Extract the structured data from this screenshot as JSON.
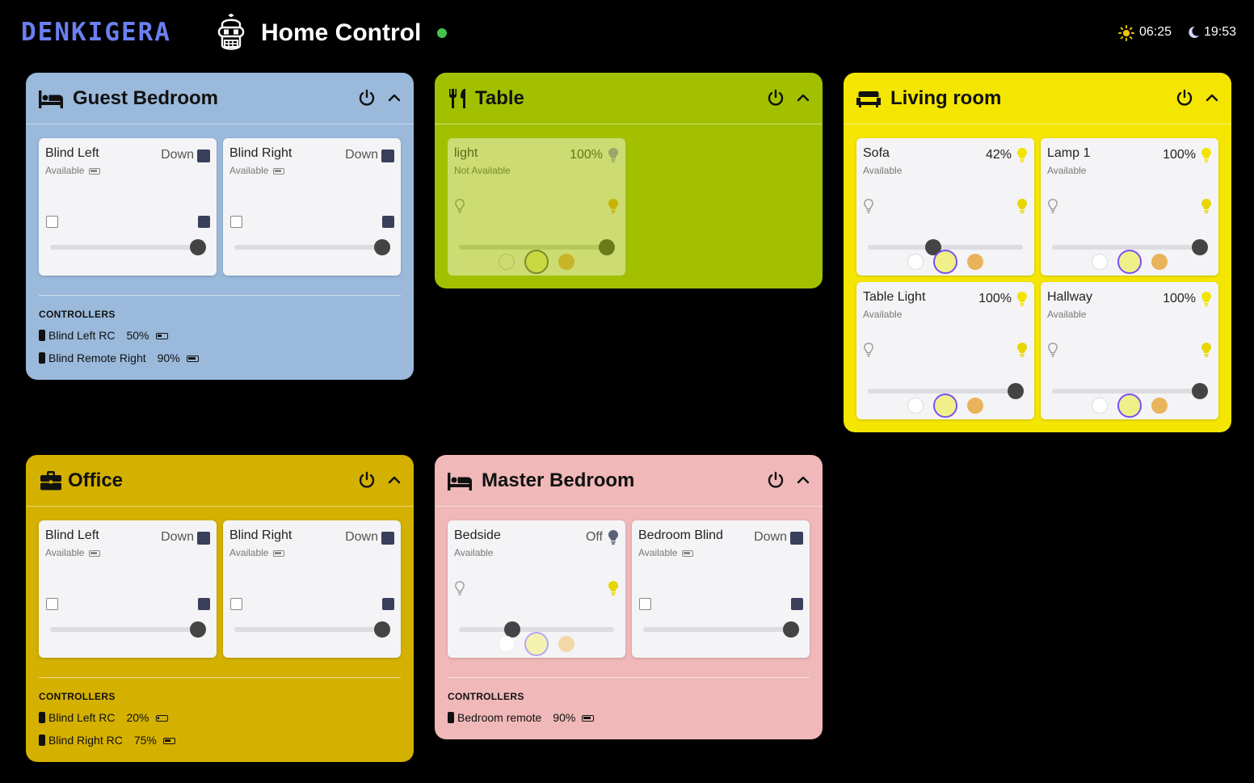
{
  "header": {
    "brand": "DENKIGERA",
    "title": "Home Control",
    "status_color": "#44c44a",
    "sunrise_time": "06:25",
    "sunset_time": "19:53",
    "sunrise_icon": "sun-icon",
    "sunset_icon": "moon-icon"
  },
  "colors": {
    "guest_bedroom": "#9ab9db",
    "table": "#a2c000",
    "living_room": "#f4e600",
    "office": "#d4b000",
    "master_bedroom": "#f0b8b8",
    "accent": "#7a4ff0"
  },
  "rooms": {
    "guest_bedroom": {
      "title": "Guest Bedroom",
      "icon": "bed-icon",
      "devices": [
        {
          "name": "Blind Left",
          "status": "Available",
          "state": "Down",
          "position_pct": 100
        },
        {
          "name": "Blind Right",
          "status": "Available",
          "state": "Down",
          "position_pct": 100
        }
      ],
      "controllers_heading": "CONTROLLERS",
      "controllers": [
        {
          "name": "Blind Left RC",
          "battery": "50%"
        },
        {
          "name": "Blind Remote Right",
          "battery": "90%"
        }
      ]
    },
    "table": {
      "title": "Table",
      "icon": "utensils-icon",
      "devices": [
        {
          "name": "light",
          "status": "Not Available",
          "state": "100%",
          "brightness_pct": 100
        }
      ]
    },
    "living_room": {
      "title": "Living room",
      "icon": "sofa-icon",
      "devices": [
        {
          "name": "Sofa",
          "status": "Available",
          "state": "42%",
          "brightness_pct": 42
        },
        {
          "name": "Lamp 1",
          "status": "Available",
          "state": "100%",
          "brightness_pct": 100
        },
        {
          "name": "Table Light",
          "status": "Available",
          "state": "100%",
          "brightness_pct": 100
        },
        {
          "name": "Hallway",
          "status": "Available",
          "state": "100%",
          "brightness_pct": 100
        }
      ]
    },
    "office": {
      "title": "Office",
      "icon": "briefcase-icon",
      "devices": [
        {
          "name": "Blind Left",
          "status": "Available",
          "state": "Down",
          "position_pct": 100
        },
        {
          "name": "Blind Right",
          "status": "Available",
          "state": "Down",
          "position_pct": 100
        }
      ],
      "controllers_heading": "CONTROLLERS",
      "controllers": [
        {
          "name": "Blind Left RC",
          "battery": "20%"
        },
        {
          "name": "Blind Right RC",
          "battery": "75%"
        }
      ]
    },
    "master_bedroom": {
      "title": "Master Bedroom",
      "icon": "bed-icon",
      "devices": [
        {
          "name": "Bedside",
          "status": "Available",
          "state": "Off",
          "brightness_pct": 36
        },
        {
          "name": "Bedroom Blind",
          "status": "Available",
          "state": "Down",
          "position_pct": 100
        }
      ],
      "controllers_heading": "CONTROLLERS",
      "controllers": [
        {
          "name": "Bedroom remote",
          "battery": "90%"
        }
      ]
    }
  }
}
